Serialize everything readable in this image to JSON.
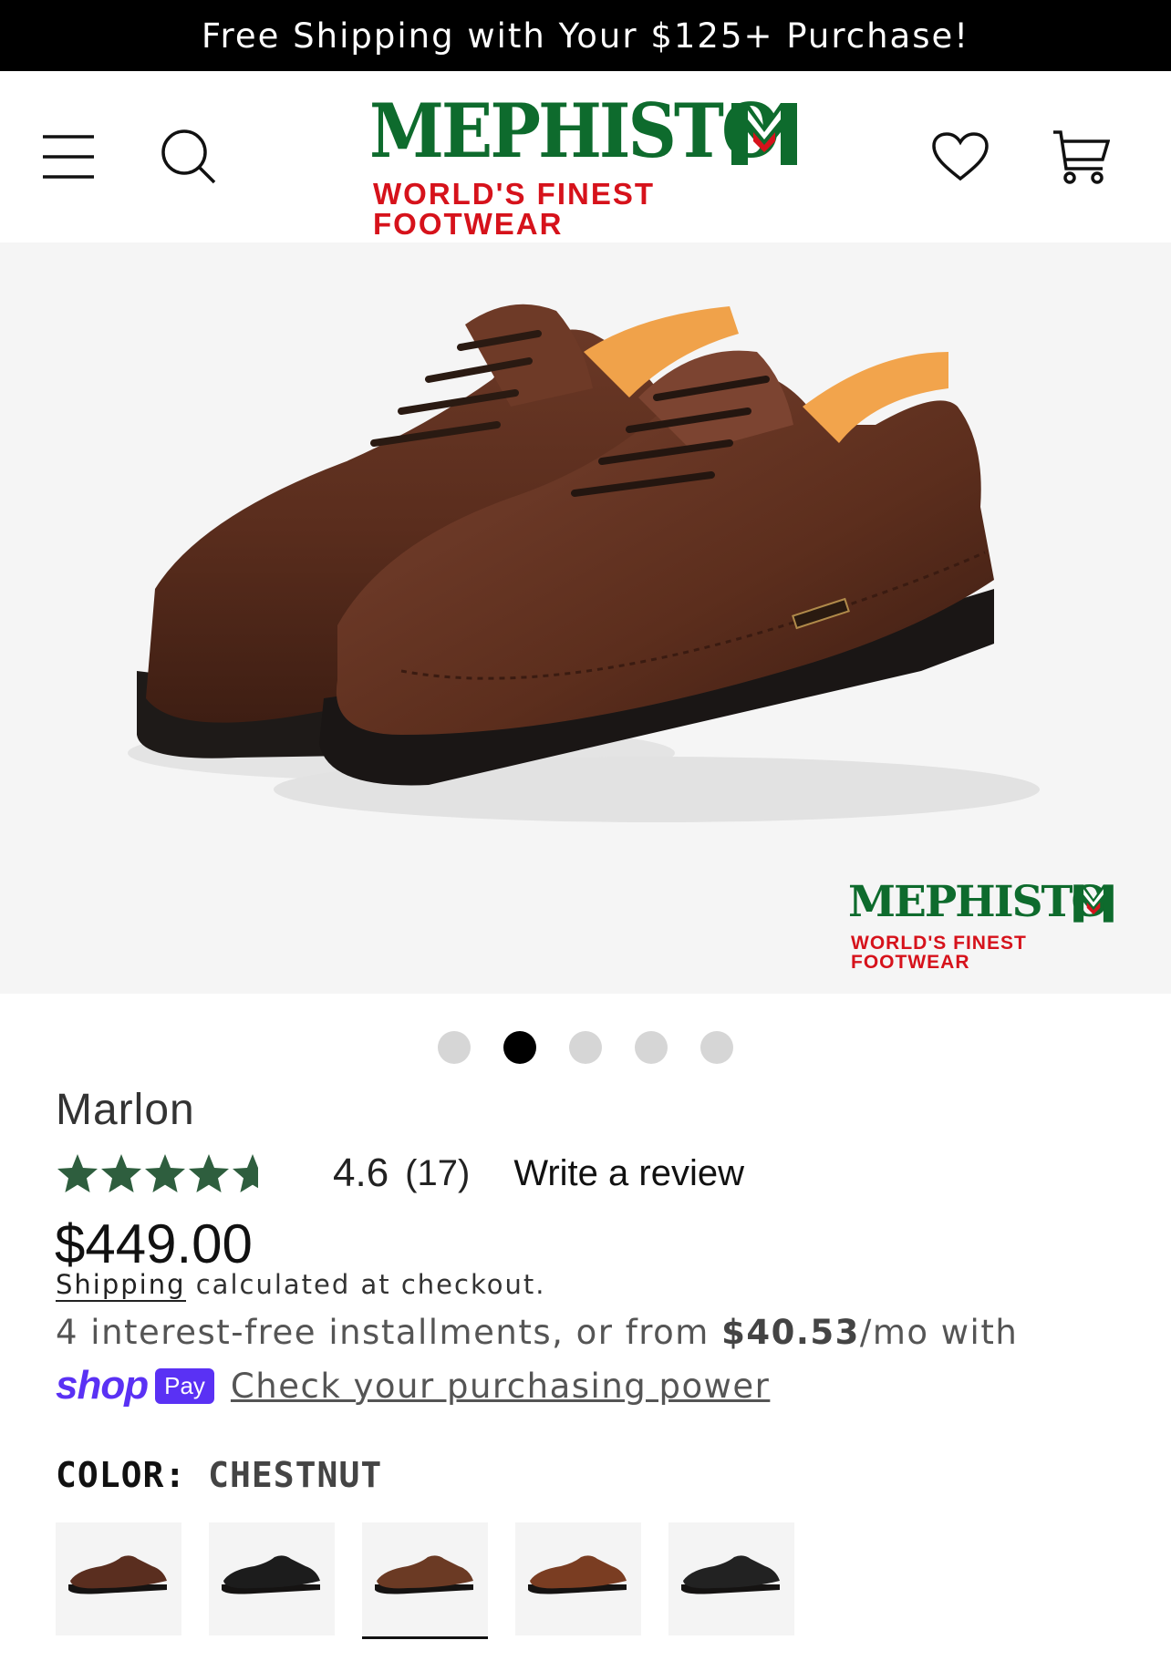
{
  "announcement": "Free Shipping with Your $125+ Purchase!",
  "header": {
    "logo_word": "MEPHISTO",
    "logo_tagline": "WORLD'S FINEST FOOTWEAR"
  },
  "hero": {
    "watermark_word": "MEPHISTO",
    "watermark_tagline": "WORLD'S FINEST FOOTWEAR",
    "slide_count": 5,
    "active_slide": 2
  },
  "product": {
    "title": "Marlon",
    "rating_value": "4.6",
    "rating_count": "(17)",
    "stars_out_of_5": 4.6,
    "write_review": "Write a review",
    "price": "$449.00",
    "shipping_link": "Shipping",
    "shipping_rest": " calculated at checkout.",
    "install_prefix": "4 interest-free installments, or from ",
    "install_amount": "$40.53",
    "install_suffix": "/mo with",
    "shop_word": "shop",
    "pay_badge": "Pay",
    "check_power": "Check your purchasing power",
    "color_label": "COLOR:",
    "color_value": "CHESTNUT"
  },
  "colors": {
    "star": "#2e5e3e",
    "brand_green": "#0e6b2d",
    "brand_red": "#d6121b",
    "shop_purple": "#5a31f4"
  },
  "swatches": [
    {
      "name": "brown",
      "color": "#5a2e1f",
      "selected": false
    },
    {
      "name": "black",
      "color": "#1c1c1c",
      "selected": false
    },
    {
      "name": "chestnut",
      "color": "#6b3a24",
      "selected": true
    },
    {
      "name": "tan",
      "color": "#7a3d22",
      "selected": false
    },
    {
      "name": "black-grain",
      "color": "#222222",
      "selected": false
    }
  ]
}
